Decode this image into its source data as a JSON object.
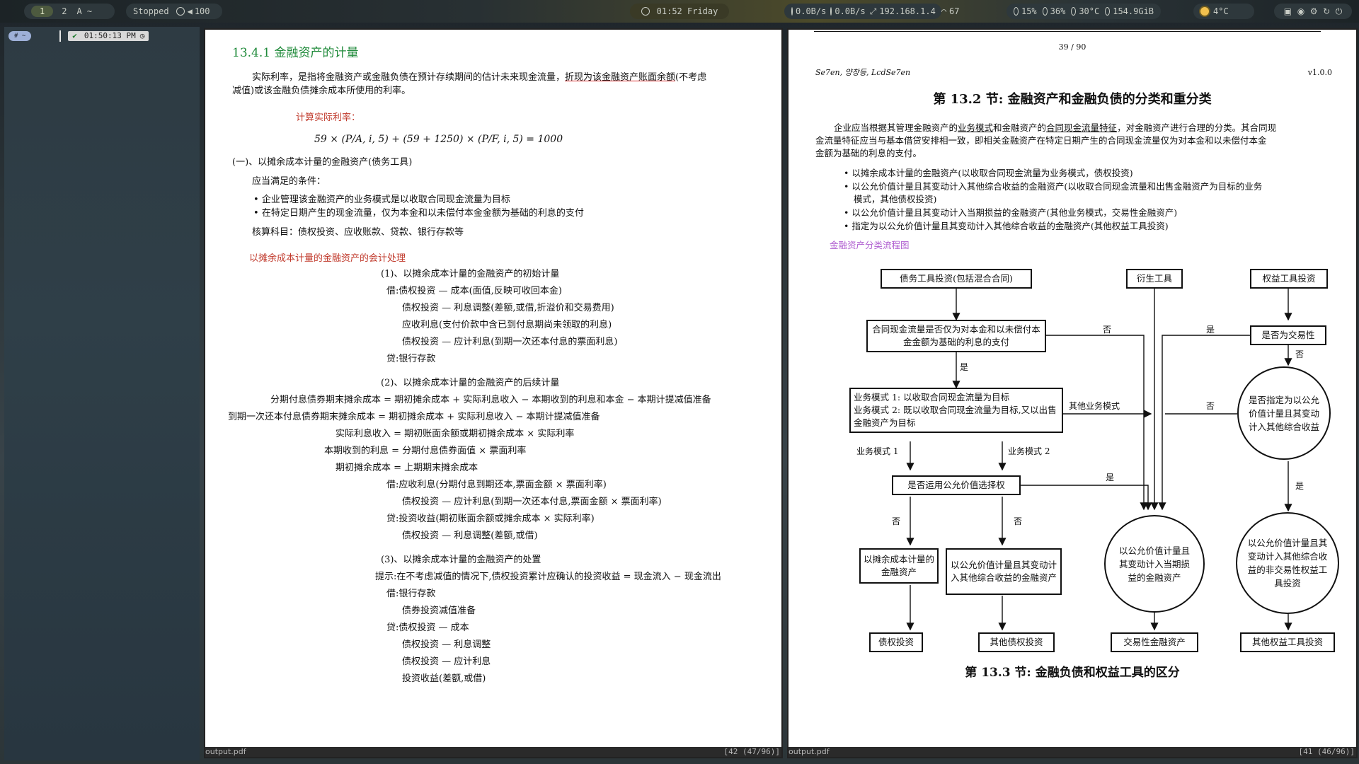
{
  "topbar": {
    "workspaces": [
      "1",
      "2"
    ],
    "layout": "A ~",
    "media": {
      "status": "Stopped",
      "volume": "100"
    },
    "clock": "01:52 Friday",
    "net": {
      "down": "0.0B/s",
      "up": "0.0B/s",
      "ip": "192.168.1.4",
      "signal": "67"
    },
    "sys": {
      "cpu": "15%",
      "mem": "36%",
      "temp": "30°C",
      "disk": "154.9GiB"
    },
    "weather": "4°C"
  },
  "leftpanel": {
    "tag": "# ~",
    "time": "01:50:13 PM"
  },
  "left_pdf": {
    "statusbar": {
      "file": "output.pdf",
      "page": "[42 (47/96)]"
    },
    "heading": "13.4.1 金融资产的计量",
    "intro1_a": "实际利率，是指将金融资产或金融负债在预计存续期间的估计未来现金流量，",
    "intro1_b": "折现为该金融资产账面余额",
    "intro1_c": "(不考虑",
    "intro2": "减值)或该金融负债摊余成本所使用的利率。",
    "calc_label": "计算实际利率：",
    "formula": "59 × (P/A, i, 5) + (59 + 1250) × (P/F, i, 5) = 1000",
    "sec1": "(一)、以摊余成本计量的金融资产(债务工具)",
    "cond_title": "应当满足的条件：",
    "bullets": [
      "企业管理该金融资产的业务模式是以收取合同现金流量为目标",
      "在特定日期产生的现金流量，仅为本金和以未偿付本金金额为基础的利息的支付"
    ],
    "accounts": "核算科目：债权投资、应收账款、贷款、银行存款等",
    "acct_title": "以摊余成本计量的金融资产的会计处理",
    "lines": [
      "(1)、以摊余成本计量的金融资产的初始计量",
      "借:债权投资 — 成本(面值,反映可收回本金)",
      "债权投资 — 利息调整(差额,或借,折溢价和交易费用)",
      "应收利息(支付价款中含已到付息期尚未领取的利息)",
      "债权投资 — 应计利息(到期一次还本付息的票面利息)",
      "贷:银行存款",
      "(2)、以摊余成本计量的金融资产的后续计量",
      "分期付息债券期末摊余成本 = 期初摊余成本 + 实际利息收入 − 本期收到的利息和本金 − 本期计提减值准备",
      "到期一次还本付息债券期末摊余成本 = 期初摊余成本 + 实际利息收入 − 本期计提减值准备",
      "实际利息收入 = 期初账面余额或期初摊余成本 × 实际利率",
      "本期收到的利息 = 分期付息债券面值 × 票面利率",
      "期初摊余成本 = 上期期末摊余成本",
      "借:应收利息(分期付息到期还本,票面金额 × 票面利率)",
      "债权投资 — 应计利息(到期一次还本付息,票面金额 × 票面利率)",
      "贷:投资收益(期初账面余额或摊余成本 × 实际利率)",
      "债权投资 — 利息调整(差额,或借)",
      "(3)、以摊余成本计量的金融资产的处置",
      "提示:在不考虑减值的情况下,债权投资累计应确认的投资收益 = 现金流入 − 现金流出",
      "借:银行存款",
      "债券投资减值准备",
      "贷:债权投资 — 成本",
      "债权投资 — 利息调整",
      "债权投资 — 应计利息",
      "投资收益(差额,或借)"
    ]
  },
  "right_pdf": {
    "statusbar": {
      "file": "output.pdf",
      "page": "[41 (46/96)]"
    },
    "page_number": "39 / 90",
    "authors": "Se7en, 양창등, LcdSe7en",
    "version": "v1.0.0",
    "heading": "第 13.2 节: 金融资产和金融负债的分类和重分类",
    "para_a": "企业应当根据其管理金融资产的",
    "para_u1": "业务模式",
    "para_b": "和金融资产的",
    "para_u2": "合同现金流量特征",
    "para_c": "，对金融资产进行合理的分类。其合同现",
    "para2": "金流量特征应当与基本借贷安排相一致，即相关金融资产在特定日期产生的合同现金流量仅为对本金和以未偿付本金",
    "para3": "金额为基础的利息的支付。",
    "bullets": [
      "以摊余成本计量的金融资产(以收取合同现金流量为业务模式，债权投资)",
      "以公允价值计量且其变动计入其他综合收益的金融资产(以收取合同现金流量和出售金融资产为目标的业务",
      "模式，其他债权投资)",
      "以公允价值计量且其变动计入当期损益的金融资产(其他业务模式，交易性金融资产)",
      "指定为以公允价值计量且其变动计入其他综合收益的金融资产(其他权益工具投资)"
    ],
    "flow_title": "金融资产分类流程图",
    "flow": {
      "debt": "债务工具投资(包括混合合同)",
      "deriv": "衍生工具",
      "equity": "权益工具投资",
      "q1": "合同现金流量是否仅为对本金和以未偿付本金金额为基础的利息的支付",
      "q_trading": "是否为交易性",
      "bm_line1": "业务模式 1: 以收取合同现金流量为目标",
      "bm_line2": "业务模式 2: 既以收取合同现金流量为目标,又以出售金融资产为目标",
      "other_bm": "其他业务模式",
      "q_designated": "是否指定为以公允价值计量且其变动计入其他综合收益",
      "bm1": "业务模式 1",
      "bm2": "业务模式 2",
      "q_fvo": "是否运用公允价值选择权",
      "amort": "以摊余成本计量的金融资产",
      "fvoci": "以公允价值计量且其变动计入其他综合收益的金融资产",
      "fvtpl": "以公允价值计量且其变动计入当期损益的金融资产",
      "fvoci_eq": "以公允价值计量且其变动计入其他综合收益的非交易性权益工具投资",
      "r_debt": "债权投资",
      "r_other_debt": "其他债权投资",
      "r_trading": "交易性金融资产",
      "r_other_eq": "其他权益工具投资",
      "yes": "是",
      "no": "否"
    },
    "next_heading": "第 13.3 节: 金融负债和权益工具的区分"
  }
}
